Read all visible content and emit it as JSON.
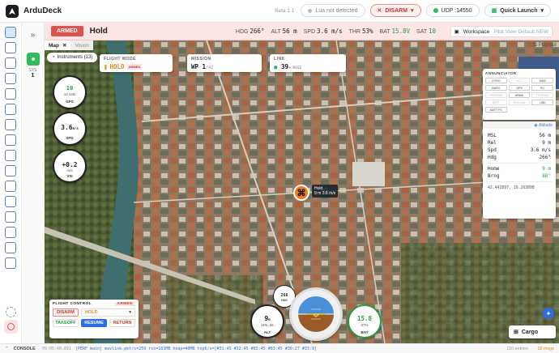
{
  "app": {
    "name": "ArduDeck",
    "version": "Beta 1.1"
  },
  "topbar": {
    "lua_status": "Lua not detected",
    "disarm_label": "DISARM",
    "connection": "UDP :14550",
    "quick_launch": "Quick Launch"
  },
  "status": {
    "armed_tag": "ARMED",
    "mode": "Hold",
    "telemetry": [
      {
        "label": "HDG",
        "value": "266°"
      },
      {
        "label": "ALT",
        "value": "56 m"
      },
      {
        "label": "SPD",
        "value": "3.6 m/s"
      },
      {
        "label": "THR",
        "value": "53%"
      },
      {
        "label": "BAT",
        "value": "15.8V"
      },
      {
        "label": "SAT",
        "value": "10"
      }
    ],
    "workspace_label": "Workspace",
    "pilot_view_label": "Pilot View Default NEW"
  },
  "sysbar": {
    "label": "SYS",
    "value": "1"
  },
  "map": {
    "tabs": [
      {
        "label": "Map"
      },
      {
        "label": "Vision"
      }
    ],
    "popout_label": "Pop out",
    "instruments_label": "Instruments (13)",
    "flight_mode": {
      "header": "FLIGHT MODE",
      "value": "HOLD",
      "tag": "ARMED"
    },
    "mission": {
      "header": "MISSION",
      "wp_label": "WP",
      "wp_value": "1",
      "wp_total": "/42"
    },
    "link": {
      "header": "LINK",
      "value": "39",
      "unit": "% RSSI"
    },
    "gauges": {
      "gps": {
        "value": "10",
        "sub": "10 sats",
        "label": "GPS"
      },
      "spd": {
        "value": "3.6",
        "sub": "m/s",
        "label": "SPD"
      },
      "vsi": {
        "value": "+0.2",
        "sub": "m/s",
        "label": "VSI"
      }
    },
    "vehicle": {
      "label": "Hold",
      "speed": "9 m 3.6 m/s"
    },
    "annunciator": {
      "header": "ANNUNCIATOR",
      "items": [
        {
          "label": "GYRO",
          "on": true
        },
        {
          "label": "ACC",
          "on": false
        },
        {
          "label": "MAG",
          "on": true
        },
        {
          "label": "BARO",
          "on": true
        },
        {
          "label": "GPS",
          "on": true
        },
        {
          "label": "RC",
          "on": true
        },
        {
          "label": "PREARM",
          "on": false
        },
        {
          "label": "ARMD",
          "on": true
        },
        {
          "label": "TERRAIN",
          "on": false
        },
        {
          "label": "BATT",
          "on": false
        },
        {
          "label": "PROXIM",
          "on": false
        },
        {
          "label": "LINK",
          "on": true
        },
        {
          "label": "BATT FS",
          "on": true
        }
      ]
    },
    "attitude_panel": {
      "header": "Attitude",
      "rows": [
        {
          "label": "MSL",
          "value": "56 m"
        },
        {
          "label": "Rel",
          "value": "9 m"
        },
        {
          "label": "Spd",
          "value": "3.6 m/s"
        },
        {
          "label": "Hdg",
          "value": "266°"
        },
        {
          "label": "Home",
          "value": "9 m"
        },
        {
          "label": "Brng",
          "value": "88°"
        }
      ],
      "coords": "42.441897, 19.263898"
    },
    "flight_control": {
      "header": "FLIGHT CONTROL",
      "tag": "ARMED",
      "disarm": "DISARM",
      "mode_select": "HOLD",
      "takeoff": "TAKEOFF",
      "resume": "RESUME",
      "return": "RETURN"
    },
    "bottom_gauges": {
      "alt": {
        "value": "9",
        "unit": "m",
        "sub": "MSL 56",
        "label": "ALT"
      },
      "hdg": {
        "value": "266",
        "label": "HDG"
      },
      "bat": {
        "value": "15.8",
        "sub": "97%",
        "label": "BAT"
      }
    },
    "cargo_label": "Cargo"
  },
  "console": {
    "label": "CONSOLE",
    "time": "09:05:40.891",
    "message": "[PERF main] mavlink-pkt/s=259 rss=183MB heap=40MB top6/s=[#31:45 #32:45 #85:45 #83:45 #30:27 #33:9]",
    "entries": "110 entries",
    "msgs": "18 msgs"
  },
  "colors": {
    "accent": "#2d6fe0",
    "armed": "#d9534f",
    "ok": "#2ebd59",
    "vehicle": "#ee7a1a"
  }
}
